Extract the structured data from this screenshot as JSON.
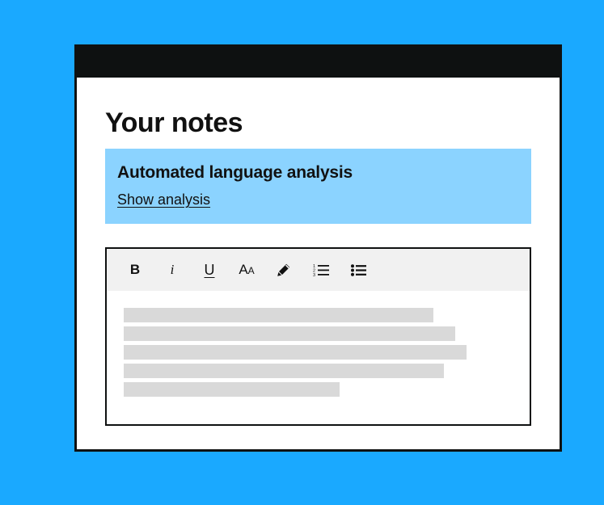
{
  "page": {
    "title": "Your notes"
  },
  "analysis": {
    "heading": "Automated language analysis",
    "link_label": "Show analysis"
  },
  "editor": {
    "toolbar": {
      "bold": "B",
      "italic": "i",
      "underline": "U",
      "font_size_large": "A",
      "font_size_small": "A",
      "tools": [
        "bold",
        "italic",
        "underline",
        "font-size",
        "highlighter",
        "numbered-list",
        "bullet-list"
      ]
    },
    "placeholder_lines": 5
  },
  "colors": {
    "background": "#1aa9ff",
    "titlebar": "#0e1111",
    "analysis_box": "#8bd3ff",
    "toolbar": "#f1f1f1",
    "placeholder_line": "#d9d9d9"
  }
}
